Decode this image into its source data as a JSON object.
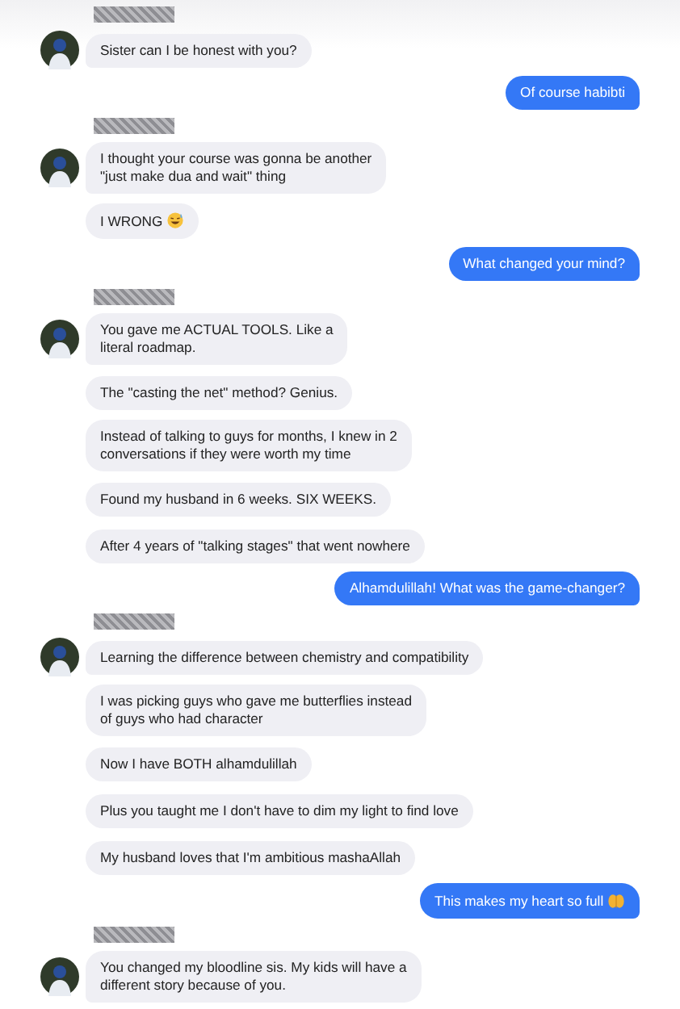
{
  "conversation": [
    {
      "sent": false,
      "messages": [
        {
          "text": "Sister can I be honest with you?"
        }
      ]
    },
    {
      "sent": true,
      "messages": [
        {
          "text": "Of course habibti"
        }
      ]
    },
    {
      "sent": false,
      "messages": [
        {
          "text": "I thought your course was gonna be another\n\"just make dua and wait\" thing"
        },
        {
          "text": "I WRONG",
          "kind": "sweat"
        }
      ]
    },
    {
      "sent": true,
      "messages": [
        {
          "text": "What changed your mind?"
        }
      ]
    },
    {
      "sent": false,
      "messages": [
        {
          "text": "You gave me ACTUAL TOOLS. Like a\nliteral roadmap."
        },
        {
          "text": "The \"casting the net\" method? Genius."
        },
        {
          "text": "Instead of talking to guys for months, I knew in 2\nconversations if they were worth my time"
        },
        {
          "text": "Found my husband in 6 weeks. SIX WEEKS."
        },
        {
          "text": "After 4 years of \"talking stages\" that went nowhere"
        }
      ]
    },
    {
      "sent": true,
      "messages": [
        {
          "text": "Alhamdulillah! What was the game-changer?"
        }
      ]
    },
    {
      "sent": false,
      "messages": [
        {
          "text": "Learning the difference between chemistry and compatibility"
        },
        {
          "text": "I was picking guys who gave me butterflies instead\nof guys who had character"
        },
        {
          "text": "Now I have BOTH alhamdulillah"
        },
        {
          "text": "Plus you taught me I don't have to dim my light to find love"
        },
        {
          "text": "My husband loves that I'm ambitious mashaAllah"
        }
      ]
    },
    {
      "sent": true,
      "messages": [
        {
          "text": "This makes my heart so full",
          "kind": "hands"
        }
      ]
    },
    {
      "sent": false,
      "messages": [
        {
          "text": "You changed my bloodline sis. My kids will have a\ndifferent story because of you."
        }
      ]
    }
  ]
}
